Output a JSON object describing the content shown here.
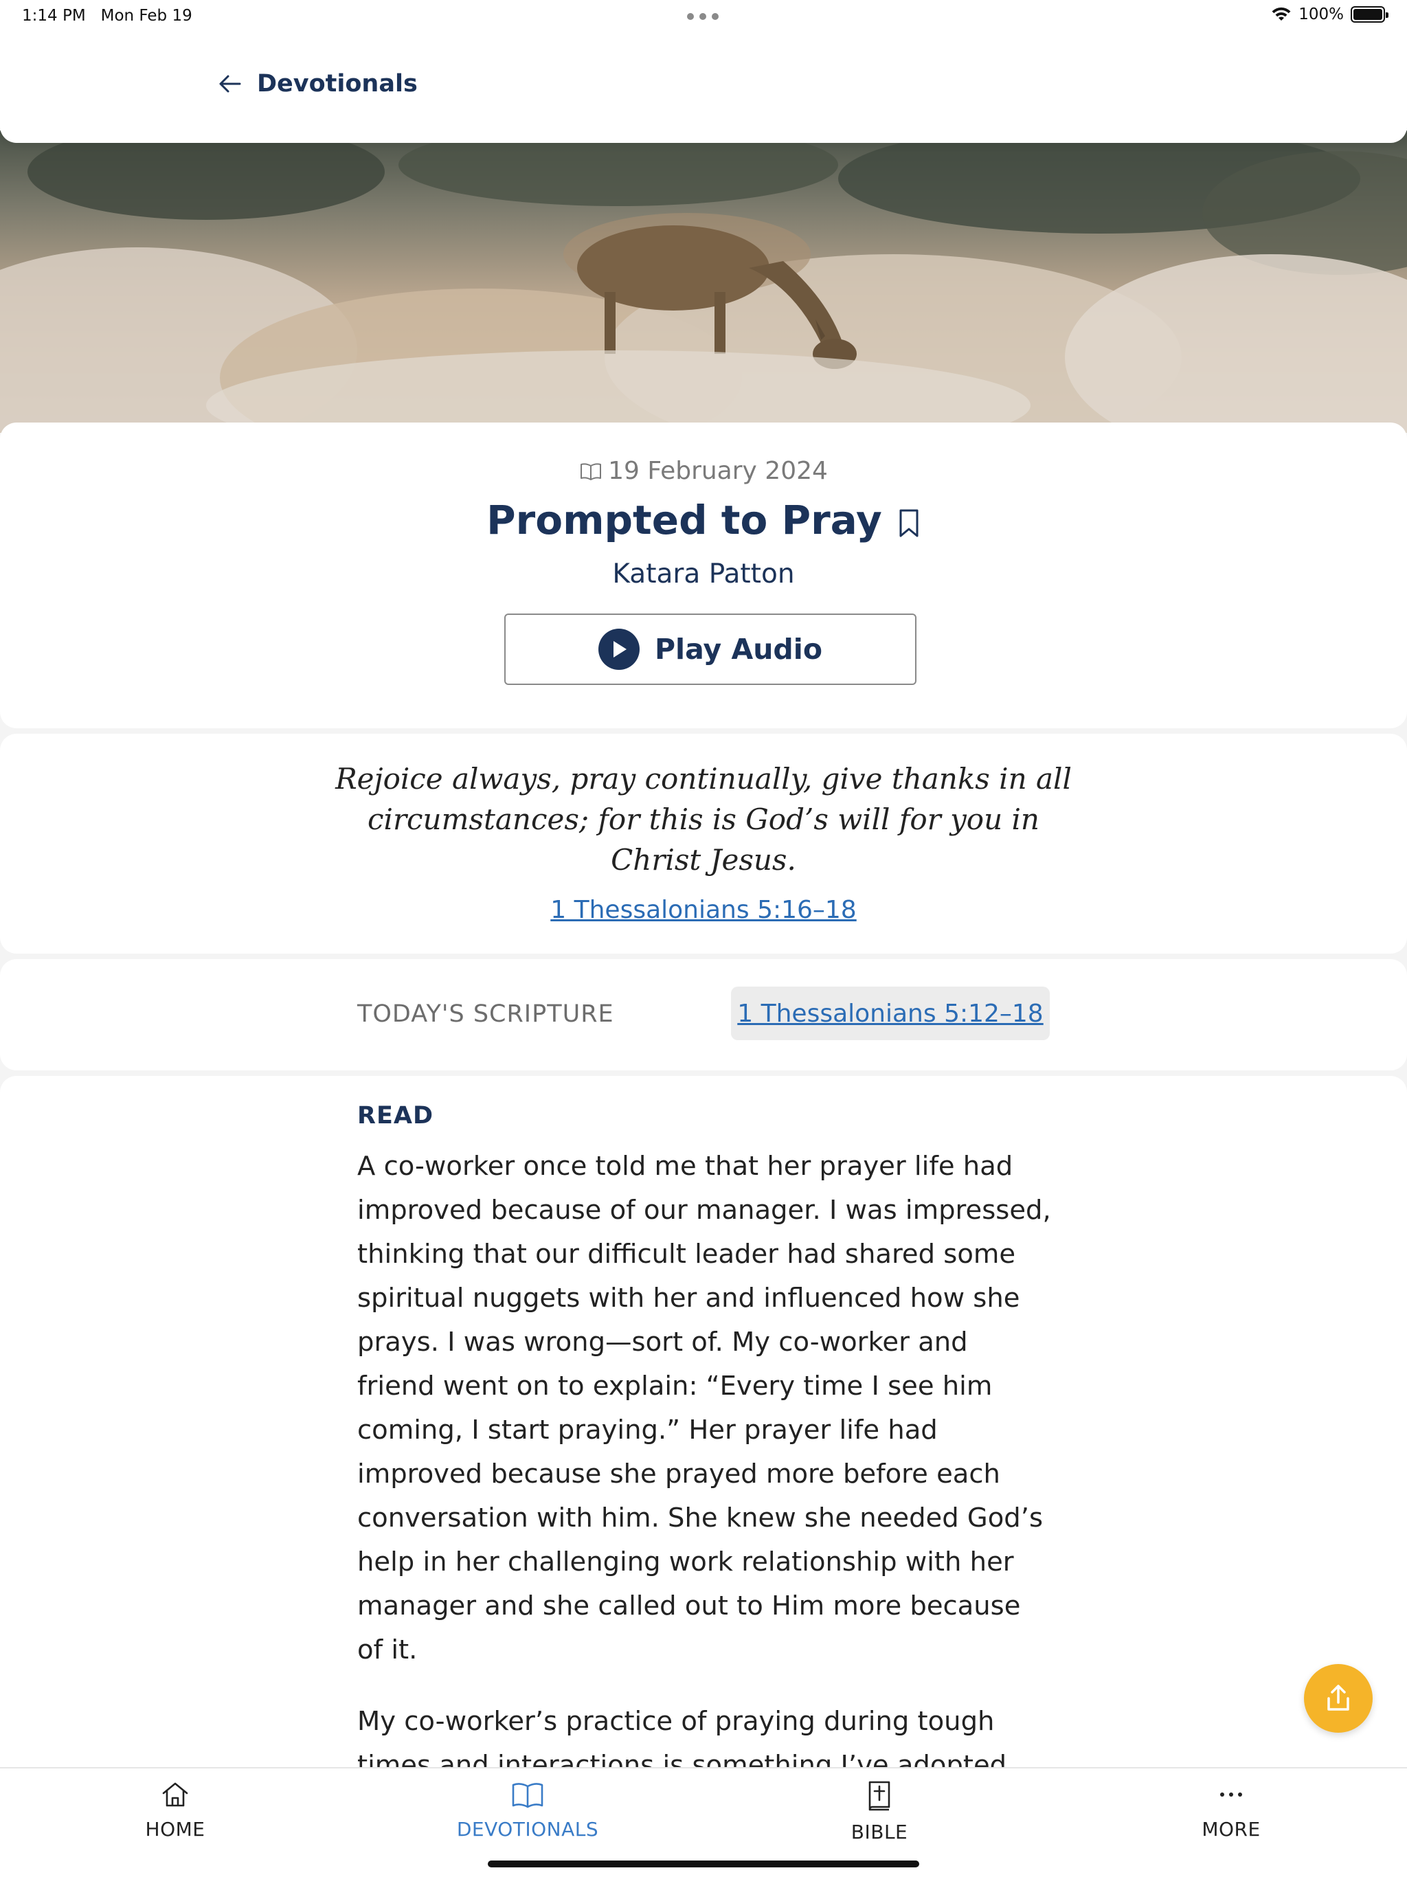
{
  "status_bar": {
    "time": "1:14 PM",
    "date": "Mon Feb 19",
    "battery": "100%"
  },
  "header": {
    "back_label": "Devotionals"
  },
  "hero": {
    "description": "deer grazing in frosted ferns"
  },
  "devotional": {
    "date": "19 February 2024",
    "title": "Prompted to Pray",
    "author": "Katara Patton",
    "play_audio_label": "Play Audio"
  },
  "verse": {
    "text": "Rejoice always, pray continually, give thanks in all circumstances; for this is God’s will for you in Christ Jesus.",
    "reference": "1 Thessalonians 5:16–18"
  },
  "scripture": {
    "label": "TODAY'S SCRIPTURE",
    "reference": "1 Thessalonians 5:12–18"
  },
  "read": {
    "heading": "READ",
    "paragraphs": [
      "A co-worker once told me that her prayer life had improved because of our manager. I was impressed, thinking that our difficult leader had shared some spiritual nuggets with her and influenced how she prays. I was wrong—sort of. My co-worker and friend went on to explain: “Every time I see him coming, I start praying.” Her prayer life had improved because she prayed more before each conversation with him. She knew she needed God’s help in her challenging work relationship with her manager and she called out to Him more because of it.",
      "My co-worker’s practice of praying during tough times and interactions is something I’ve adopted."
    ]
  },
  "tab_bar": {
    "items": [
      {
        "label": "HOME",
        "icon": "home-icon",
        "active": false
      },
      {
        "label": "DEVOTIONALS",
        "icon": "open-book-icon",
        "active": true
      },
      {
        "label": "BIBLE",
        "icon": "bible-icon",
        "active": false
      },
      {
        "label": "MORE",
        "icon": "more-dots-icon",
        "active": false
      }
    ]
  },
  "colors": {
    "primary_navy": "#1c3359",
    "link_blue": "#2b6cb5",
    "active_tab_blue": "#3a7cc7",
    "share_button": "#f5b429"
  }
}
